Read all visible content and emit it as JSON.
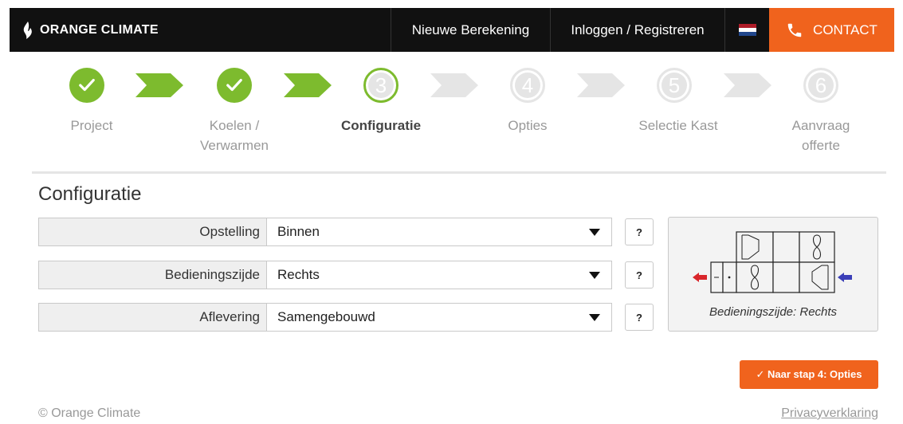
{
  "navbar": {
    "brand": "ORANGE CLIMATE",
    "new_calc": "Nieuwe Berekening",
    "login": "Inloggen / Registreren",
    "contact": "CONTACT",
    "colors": {
      "bg": "#111111",
      "accent": "#f0631d"
    },
    "flag_icon": "dutch-flag-icon",
    "phone_icon": "phone-icon"
  },
  "steps": [
    {
      "number": "1",
      "label": "Project",
      "state": "done"
    },
    {
      "number": "2",
      "label": "Koelen / Verwarmen",
      "state": "done"
    },
    {
      "number": "3",
      "label": "Configuratie",
      "state": "current"
    },
    {
      "number": "4",
      "label": "Opties",
      "state": "future"
    },
    {
      "number": "5",
      "label": "Selectie Kast",
      "state": "future"
    },
    {
      "number": "6",
      "label": "Aanvraag offerte",
      "state": "future"
    }
  ],
  "step_colors": {
    "done": "#7dbb2e",
    "inactive": "#e5e5e5"
  },
  "form": {
    "title": "Configuratie",
    "fields": [
      {
        "label": "Opstelling",
        "value": "Binnen",
        "help": "?"
      },
      {
        "label": "Bedieningszijde",
        "value": "Rechts",
        "help": "?"
      },
      {
        "label": "Aflevering",
        "value": "Samengebouwd",
        "help": "?"
      }
    ]
  },
  "preview": {
    "caption": "Bedieningszijde: Rechts",
    "arrow_left_color": "#d9262b",
    "arrow_right_color": "#3b3fb8"
  },
  "cta": {
    "label": "✓ Naar stap 4: Opties"
  },
  "footer": {
    "copyright": "© Orange Climate",
    "privacy": "Privacyverklaring"
  }
}
